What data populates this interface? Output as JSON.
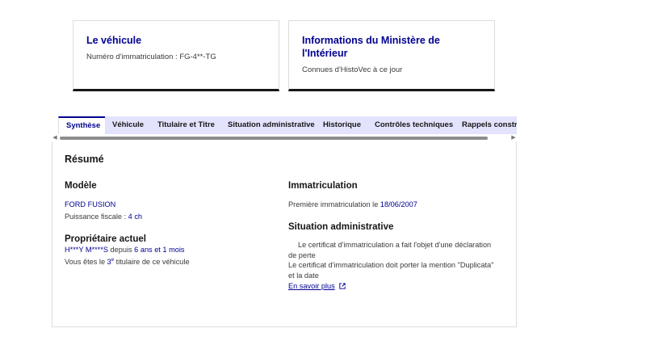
{
  "cards": [
    {
      "title": "Le véhicule",
      "desc": "Numéro d'immatriculation : FG-4**-TG"
    },
    {
      "title": "Informations du Ministère de l'Intérieur",
      "desc": "Connues d'HistoVec à ce jour"
    }
  ],
  "tabs": [
    {
      "label": "Synthèse",
      "active": true
    },
    {
      "label": "Véhicule"
    },
    {
      "label": "Titulaire et Titre"
    },
    {
      "label": "Situation administrative"
    },
    {
      "label": "Historique"
    },
    {
      "label": "Contrôles techniques"
    },
    {
      "label": "Rappels constructeur"
    }
  ],
  "summary": {
    "title": "Résumé",
    "modele": {
      "heading": "Modèle",
      "name": "FORD FUSION",
      "puissance_label": "Puissance fiscale :",
      "puissance_value": "4 ch"
    },
    "proprietaire": {
      "heading": "Propriétaire actuel",
      "name": "H***Y M****S",
      "depuis": "depuis",
      "duree": "6 ans et 1 mois",
      "rang_prefix": "Vous êtes le",
      "rang_num": "3",
      "rang_sup": "e",
      "rang_suffix": "titulaire de ce véhicule"
    },
    "immatriculation": {
      "heading": "Immatriculation",
      "label": "Première immatriculation le",
      "date": "18/06/2007"
    },
    "situation": {
      "heading": "Situation administrative",
      "line1": "Le certificat d'immatriculation a fait l'objet d'une déclaration",
      "line2": "de perte",
      "line3": "Le certificat d'immatriculation doit porter la mention \"Duplicata\"",
      "line4": "et la date",
      "link": "En savoir plus"
    }
  },
  "colors": {
    "accent": "#000091",
    "tab_bg": "#e3e3fd",
    "text": "#161616"
  },
  "icons": {
    "external_link": "external-link-icon",
    "scroll_left": "arrow-left-icon",
    "scroll_right": "arrow-right-icon"
  }
}
